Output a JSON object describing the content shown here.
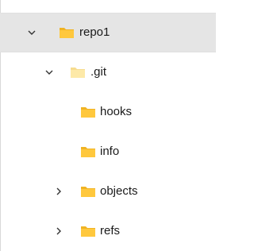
{
  "tree": {
    "items": [
      {
        "label": "repo1",
        "expanded": true,
        "has_children": true,
        "selected": true,
        "icon": "folder-icon",
        "chevron": "chevron-down-icon"
      },
      {
        "label": ".git",
        "expanded": true,
        "has_children": true,
        "selected": false,
        "icon": "hidden-folder-icon",
        "chevron": "chevron-down-icon"
      },
      {
        "label": "hooks",
        "expanded": false,
        "has_children": false,
        "selected": false,
        "icon": "folder-icon",
        "chevron": ""
      },
      {
        "label": "info",
        "expanded": false,
        "has_children": false,
        "selected": false,
        "icon": "folder-icon",
        "chevron": ""
      },
      {
        "label": "objects",
        "expanded": false,
        "has_children": true,
        "selected": false,
        "icon": "folder-icon",
        "chevron": "chevron-right-icon"
      },
      {
        "label": "refs",
        "expanded": false,
        "has_children": true,
        "selected": false,
        "icon": "folder-icon",
        "chevron": "chevron-right-icon"
      }
    ]
  },
  "colors": {
    "selected_bg": "#e5e5e5",
    "folder_yellow": "#ffc83d",
    "folder_back": "#f0b323",
    "hidden_folder": "#fde9a8",
    "text": "#1a1a1a",
    "chevron": "#333333"
  }
}
